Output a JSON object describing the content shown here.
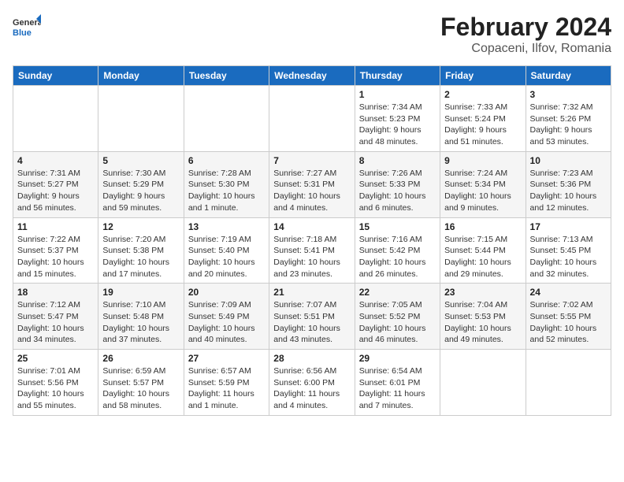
{
  "logo": {
    "line1": "General",
    "line2": "Blue"
  },
  "title": "February 2024",
  "subtitle": "Copaceni, Ilfov, Romania",
  "days_of_week": [
    "Sunday",
    "Monday",
    "Tuesday",
    "Wednesday",
    "Thursday",
    "Friday",
    "Saturday"
  ],
  "weeks": [
    [
      {
        "day": "",
        "info": ""
      },
      {
        "day": "",
        "info": ""
      },
      {
        "day": "",
        "info": ""
      },
      {
        "day": "",
        "info": ""
      },
      {
        "day": "1",
        "info": "Sunrise: 7:34 AM\nSunset: 5:23 PM\nDaylight: 9 hours\nand 48 minutes."
      },
      {
        "day": "2",
        "info": "Sunrise: 7:33 AM\nSunset: 5:24 PM\nDaylight: 9 hours\nand 51 minutes."
      },
      {
        "day": "3",
        "info": "Sunrise: 7:32 AM\nSunset: 5:26 PM\nDaylight: 9 hours\nand 53 minutes."
      }
    ],
    [
      {
        "day": "4",
        "info": "Sunrise: 7:31 AM\nSunset: 5:27 PM\nDaylight: 9 hours\nand 56 minutes."
      },
      {
        "day": "5",
        "info": "Sunrise: 7:30 AM\nSunset: 5:29 PM\nDaylight: 9 hours\nand 59 minutes."
      },
      {
        "day": "6",
        "info": "Sunrise: 7:28 AM\nSunset: 5:30 PM\nDaylight: 10 hours\nand 1 minute."
      },
      {
        "day": "7",
        "info": "Sunrise: 7:27 AM\nSunset: 5:31 PM\nDaylight: 10 hours\nand 4 minutes."
      },
      {
        "day": "8",
        "info": "Sunrise: 7:26 AM\nSunset: 5:33 PM\nDaylight: 10 hours\nand 6 minutes."
      },
      {
        "day": "9",
        "info": "Sunrise: 7:24 AM\nSunset: 5:34 PM\nDaylight: 10 hours\nand 9 minutes."
      },
      {
        "day": "10",
        "info": "Sunrise: 7:23 AM\nSunset: 5:36 PM\nDaylight: 10 hours\nand 12 minutes."
      }
    ],
    [
      {
        "day": "11",
        "info": "Sunrise: 7:22 AM\nSunset: 5:37 PM\nDaylight: 10 hours\nand 15 minutes."
      },
      {
        "day": "12",
        "info": "Sunrise: 7:20 AM\nSunset: 5:38 PM\nDaylight: 10 hours\nand 17 minutes."
      },
      {
        "day": "13",
        "info": "Sunrise: 7:19 AM\nSunset: 5:40 PM\nDaylight: 10 hours\nand 20 minutes."
      },
      {
        "day": "14",
        "info": "Sunrise: 7:18 AM\nSunset: 5:41 PM\nDaylight: 10 hours\nand 23 minutes."
      },
      {
        "day": "15",
        "info": "Sunrise: 7:16 AM\nSunset: 5:42 PM\nDaylight: 10 hours\nand 26 minutes."
      },
      {
        "day": "16",
        "info": "Sunrise: 7:15 AM\nSunset: 5:44 PM\nDaylight: 10 hours\nand 29 minutes."
      },
      {
        "day": "17",
        "info": "Sunrise: 7:13 AM\nSunset: 5:45 PM\nDaylight: 10 hours\nand 32 minutes."
      }
    ],
    [
      {
        "day": "18",
        "info": "Sunrise: 7:12 AM\nSunset: 5:47 PM\nDaylight: 10 hours\nand 34 minutes."
      },
      {
        "day": "19",
        "info": "Sunrise: 7:10 AM\nSunset: 5:48 PM\nDaylight: 10 hours\nand 37 minutes."
      },
      {
        "day": "20",
        "info": "Sunrise: 7:09 AM\nSunset: 5:49 PM\nDaylight: 10 hours\nand 40 minutes."
      },
      {
        "day": "21",
        "info": "Sunrise: 7:07 AM\nSunset: 5:51 PM\nDaylight: 10 hours\nand 43 minutes."
      },
      {
        "day": "22",
        "info": "Sunrise: 7:05 AM\nSunset: 5:52 PM\nDaylight: 10 hours\nand 46 minutes."
      },
      {
        "day": "23",
        "info": "Sunrise: 7:04 AM\nSunset: 5:53 PM\nDaylight: 10 hours\nand 49 minutes."
      },
      {
        "day": "24",
        "info": "Sunrise: 7:02 AM\nSunset: 5:55 PM\nDaylight: 10 hours\nand 52 minutes."
      }
    ],
    [
      {
        "day": "25",
        "info": "Sunrise: 7:01 AM\nSunset: 5:56 PM\nDaylight: 10 hours\nand 55 minutes."
      },
      {
        "day": "26",
        "info": "Sunrise: 6:59 AM\nSunset: 5:57 PM\nDaylight: 10 hours\nand 58 minutes."
      },
      {
        "day": "27",
        "info": "Sunrise: 6:57 AM\nSunset: 5:59 PM\nDaylight: 11 hours\nand 1 minute."
      },
      {
        "day": "28",
        "info": "Sunrise: 6:56 AM\nSunset: 6:00 PM\nDaylight: 11 hours\nand 4 minutes."
      },
      {
        "day": "29",
        "info": "Sunrise: 6:54 AM\nSunset: 6:01 PM\nDaylight: 11 hours\nand 7 minutes."
      },
      {
        "day": "",
        "info": ""
      },
      {
        "day": "",
        "info": ""
      }
    ]
  ]
}
